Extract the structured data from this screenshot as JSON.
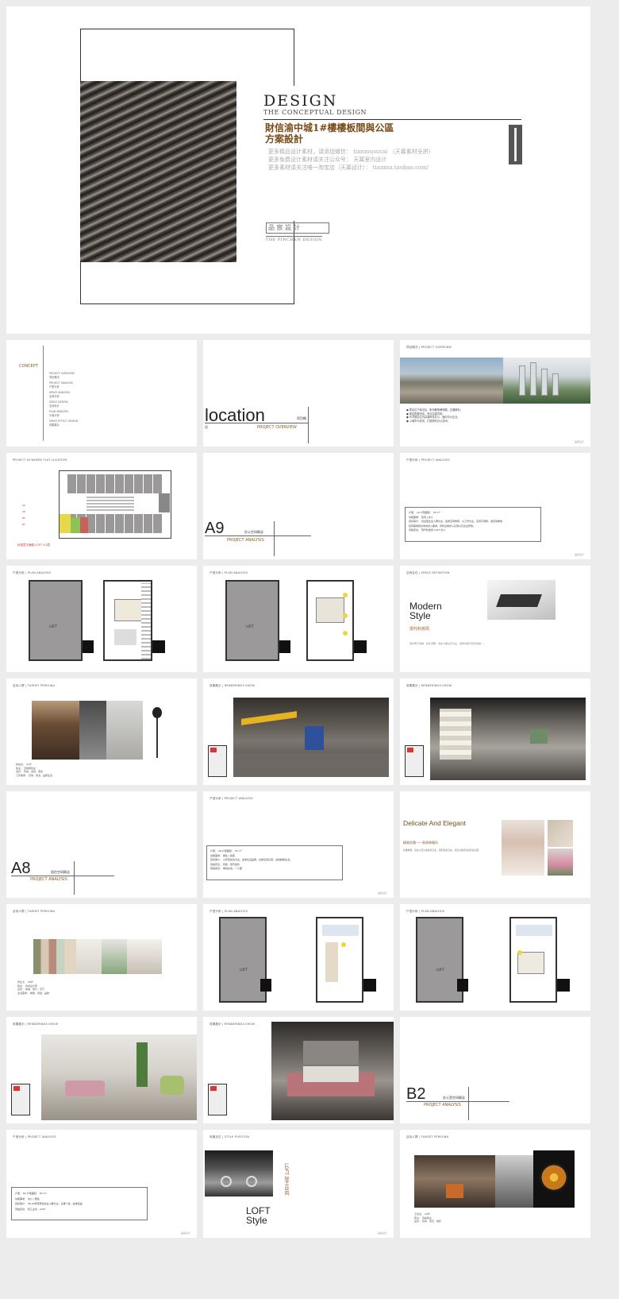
{
  "cover": {
    "design": "DESIGN",
    "conceptual": "THE CONCEPTUAL DESIGN",
    "title_line1": "財信渝中城1#樓樓板間與公區",
    "title_line2": "方案設計",
    "info": [
      "更多精品设计素材，请添加微信：  tianmusucai  （天幕素材全拼）",
      "更多免费设计素材请关注公众号：  天幕室内设计",
      "更多素材请关注唯一淘宝店（天幕设计）：  tianmu.taobao.com/"
    ],
    "logo_text": "THE PINCHEN DESIGN"
  },
  "concept": {
    "title": "CONCEPT",
    "items": [
      [
        "PROJECT OVERVIEW",
        "项目概况"
      ],
      [
        "PROJECT ANALYSIS",
        "户型分析"
      ],
      [
        "SPACE ANALYSIS",
        "空间分析"
      ],
      [
        "SPACE DESIGN",
        "空间设计"
      ],
      [
        "PLAN ANALYSIS",
        "平面分析"
      ],
      [
        "SPACE EFFECT DESIGN",
        "效果展示"
      ]
    ]
  },
  "location": {
    "word": "location",
    "cn": "项目概",
    "cn2": "况",
    "en": "PROJECT OVERVIEW"
  },
  "overview": {
    "hdr": "项目概况 | PROJECT OVERVIEW",
    "lines": [
      "● 项目位于渝中区，毗邻解放碑商圈，交通便利。",
      "● 周边配套完善，商业氛围浓厚。",
      "● 写字楼定位为高端商务办公，面向中小企业。",
      "● 以城市为背景，打造现代办公空间。"
    ]
  },
  "location_plan": {
    "hdr": "PROJECT IN WHERE FLAT LOCATION",
    "legend": [
      "A9",
      "A8",
      "B2",
      "B1"
    ],
    "note": "标准层平面图  LOFT 4.5层"
  },
  "a9": {
    "code": "A9",
    "cn": "办公空间概念",
    "en": "PROJECT ANALYSIS"
  },
  "a9_analysis": {
    "hdr": "户型分析 | PROJECT ANALYSIS",
    "lines": [
      "户型：  A9 户型面积：  50 m²",
      "功能需求：  接待 | 办公",
      "目标客户：  创业型企业人群为主，追求空间效率，以工作为主，空间可调整，满足简单的",
      "接待需求和基本的办公需求，同时注重办公氛围以及企业形象。",
      "风格定位：  现代科技风   LOFT 办公"
    ]
  },
  "plan_hdr": "户型分析 | PLAN ANALYSIS",
  "plan_labels": [
    "接待区",
    "LOFT",
    "办公区"
  ],
  "modern": {
    "hdr": "空间定位 | SPACE DEFINITION",
    "title1": "Modern",
    "title2": "Style",
    "cn": "现代科技风",
    "desc": "简约而不简单，线条流畅，色彩以黑白灰为主，强调功能与形式的统一。"
  },
  "persona1": {
    "hdr": "目标人群 | TARGET PERSONA",
    "lines": [
      "林先生：  31岁",
      "职业：  互联网创业",
      "爱好：  科技、运动、阅读",
      "工作需求：  高效、简洁、品质生活"
    ]
  },
  "render_hdr": "效果展示 | RENDERINGS SHOW",
  "a8": {
    "code": "A8",
    "cn": "居住空间概念",
    "en": "PROJECT ANALYSIS"
  },
  "a8_analysis": {
    "hdr": "户型分析 | PROJECT ANALYSIS",
    "lines": [
      "户型：  A8 户型面积：  55 m²",
      "功能需求：  居住 | 会客",
      "目标客户：  以年轻女性为主，追求生活品质，注重空间氛围，喜欢精致生活。",
      "风格定位：  轻奢 · 现代简约",
      "家庭成员：  单身女性，一人居"
    ]
  },
  "delicate": {
    "title": "Delicate And Elegant",
    "cn": "精致优雅——高贵典雅风",
    "desc": "优雅精致，色彩以莫兰迪色系为主，搭配金属元素，营造高级舒适的居住氛围。"
  },
  "persona2": {
    "hdr": "目标人群 | TARGET PERSONA",
    "lines": [
      "张女士：  28岁",
      "职业：  时尚设计师",
      "爱好：  瑜伽、旅行、花艺",
      "生活需求：  精致、舒适、品味"
    ]
  },
  "b2": {
    "code": "B2",
    "cn": "办公室空间概念",
    "en": "PROJECT ANALYSIS"
  },
  "b2_analysis": {
    "hdr": "户型分析 | PROJECT ANALYSIS",
    "lines": [
      "户型：  B2 户型面积：  60 m²",
      "功能需求：  办公 | 居住",
      "目标客户：  80-90年轻男性创业人群为主，注重个性，追求自由",
      "风格定位：  轻工业风 · LOFT"
    ]
  },
  "loft": {
    "hdr": "风格定位 | STYLE POSITION",
    "title1": "LOFT",
    "title2": "Style",
    "cn": "LOFT 轻工业风"
  },
  "persona3": {
    "hdr": "目标人群 | TARGET PERSONA",
    "lines": [
      "王先生：  29岁",
      "职业：  自由职业",
      "爱好：  机车、音乐、摄影"
    ]
  },
  "footer_brand": "品宸设计"
}
